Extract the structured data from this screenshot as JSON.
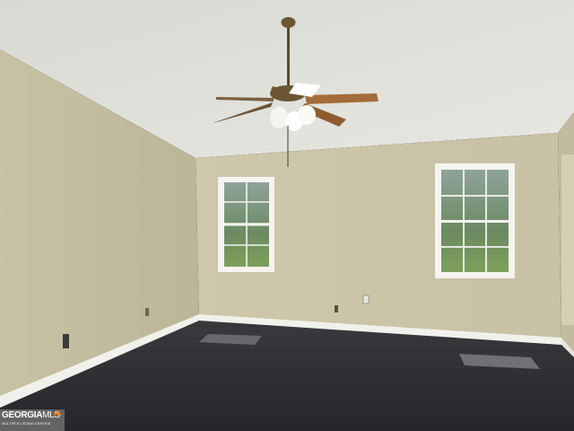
{
  "scene": {
    "description_colors": {
      "wall": "#cfc6a9",
      "wall_shadow": "#b8b095",
      "ceiling": "#e2e2dc",
      "floor": "#2f2f33",
      "trim": "#f2f2ee",
      "window_glass": "#6f8a6a"
    }
  },
  "watermark": {
    "brand_main": "GEORGIA",
    "brand_suffix": "MLS",
    "tagline": "MULTIPLE LISTING SERVICE"
  }
}
